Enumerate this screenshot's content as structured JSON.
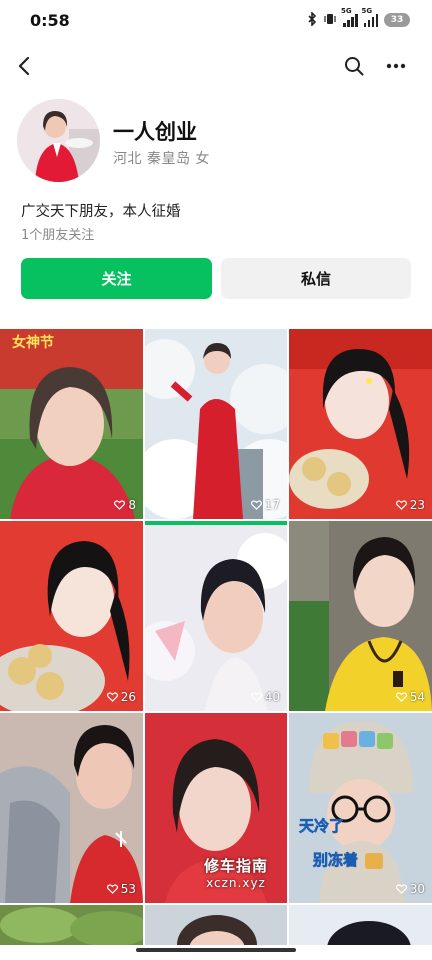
{
  "status_bar": {
    "time": "0:58",
    "battery": "33",
    "net1": "5G",
    "net2": "5G"
  },
  "profile": {
    "name": "一人创业",
    "location": "河北 秦皇岛 女",
    "bio": "广交天下朋友，本人征婚",
    "friends": "1个朋友关注"
  },
  "actions": {
    "follow": "关注",
    "message": "私信"
  },
  "videos": [
    {
      "likes": "8"
    },
    {
      "likes": "17"
    },
    {
      "likes": "23"
    },
    {
      "likes": "26"
    },
    {
      "likes": "40"
    },
    {
      "likes": "54"
    },
    {
      "likes": "53"
    },
    {
      "likes": ""
    },
    {
      "likes": "30"
    }
  ],
  "watermark": {
    "line1": "修车指南",
    "line2": "xczn.xyz"
  },
  "colors": {
    "accent": "#07c160",
    "secondary_button": "#f1f1f1",
    "muted_text": "#888888"
  }
}
